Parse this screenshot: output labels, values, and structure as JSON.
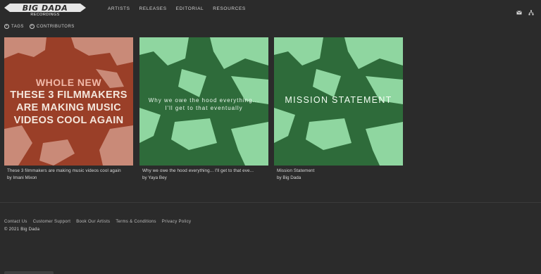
{
  "brand": {
    "logo": "BIG DADA",
    "subtitle": "RECORDINGS"
  },
  "nav": [
    {
      "label": "ARTISTS"
    },
    {
      "label": "RELEASES"
    },
    {
      "label": "EDITORIAL"
    },
    {
      "label": "RESOURCES"
    }
  ],
  "top_icons": [
    "mail-icon",
    "sitemap-icon"
  ],
  "filters": [
    {
      "label": "TAGS",
      "icon": "plus-circle-icon"
    },
    {
      "label": "CONTRIBUTORS",
      "icon": "plus-circle-icon"
    }
  ],
  "cards": [
    {
      "thumb_line1": "WHOLE NEW",
      "thumb_line2": "THESE 3 FILMMAKERS ARE MAKING MUSIC VIDEOS COOL AGAIN",
      "title": "These 3 filmmakers are making music videos cool again",
      "author": "by Imani Mixon",
      "colors": {
        "bg": "#9a3f28",
        "fg": "#c98a78"
      }
    },
    {
      "thumb_line1": "Why we owe the hood everything...",
      "thumb_line2": "I'll get to that eventually",
      "title": "Why we owe the hood everything... I'll get to that eve...",
      "author": "by Yaya Bey",
      "colors": {
        "bg": "#2e6b3a",
        "fg": "#8fd6a0"
      }
    },
    {
      "thumb_line1": "MISSION STATEMENT",
      "title": "Mission Statement",
      "author": "by Big Dada",
      "colors": {
        "bg": "#2e6b3a",
        "fg": "#8fd6a0"
      }
    }
  ],
  "footer": {
    "links": [
      "Contact Us",
      "Customer Support",
      "Book Our Artists",
      "Terms & Conditions",
      "Privacy Policy"
    ],
    "copyright": "© 2021 Big Dada"
  }
}
